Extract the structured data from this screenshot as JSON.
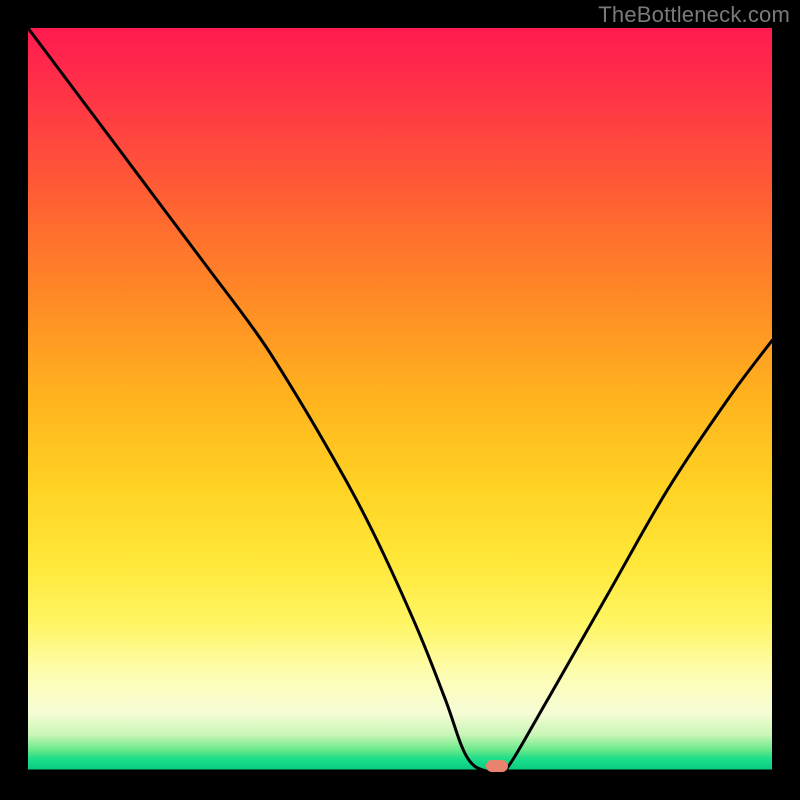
{
  "watermark": "TheBottleneck.com",
  "colors": {
    "frame_bg": "#000000",
    "marker": "#e9836f",
    "curve": "#000000",
    "gradient_top": "#ff1a4f",
    "gradient_mid": "#ffd324",
    "gradient_bottom": "#05d184"
  },
  "chart_data": {
    "type": "line",
    "title": "",
    "xlabel": "",
    "ylabel": "",
    "xlim": [
      0,
      100
    ],
    "ylim": [
      0,
      100
    ],
    "grid": false,
    "legend": false,
    "notes": "V-shaped bottleneck curve over vertical red→yellow→green gradient. y≈0 (green) is optimal; higher y (red) is worse. Minimum plateau around x≈60–64 with a salmon pill marker at the minimum.",
    "series": [
      {
        "name": "bottleneck-curve",
        "x": [
          0,
          6,
          12,
          18,
          24,
          30,
          34,
          40,
          46,
          52,
          56,
          59,
          62,
          64,
          70,
          78,
          86,
          94,
          100
        ],
        "y": [
          100,
          92,
          84,
          76,
          68,
          60,
          54,
          44,
          33,
          20,
          10,
          2,
          0,
          0,
          10,
          24,
          38,
          50,
          58
        ]
      }
    ],
    "marker": {
      "x": 63,
      "y": 0
    }
  }
}
